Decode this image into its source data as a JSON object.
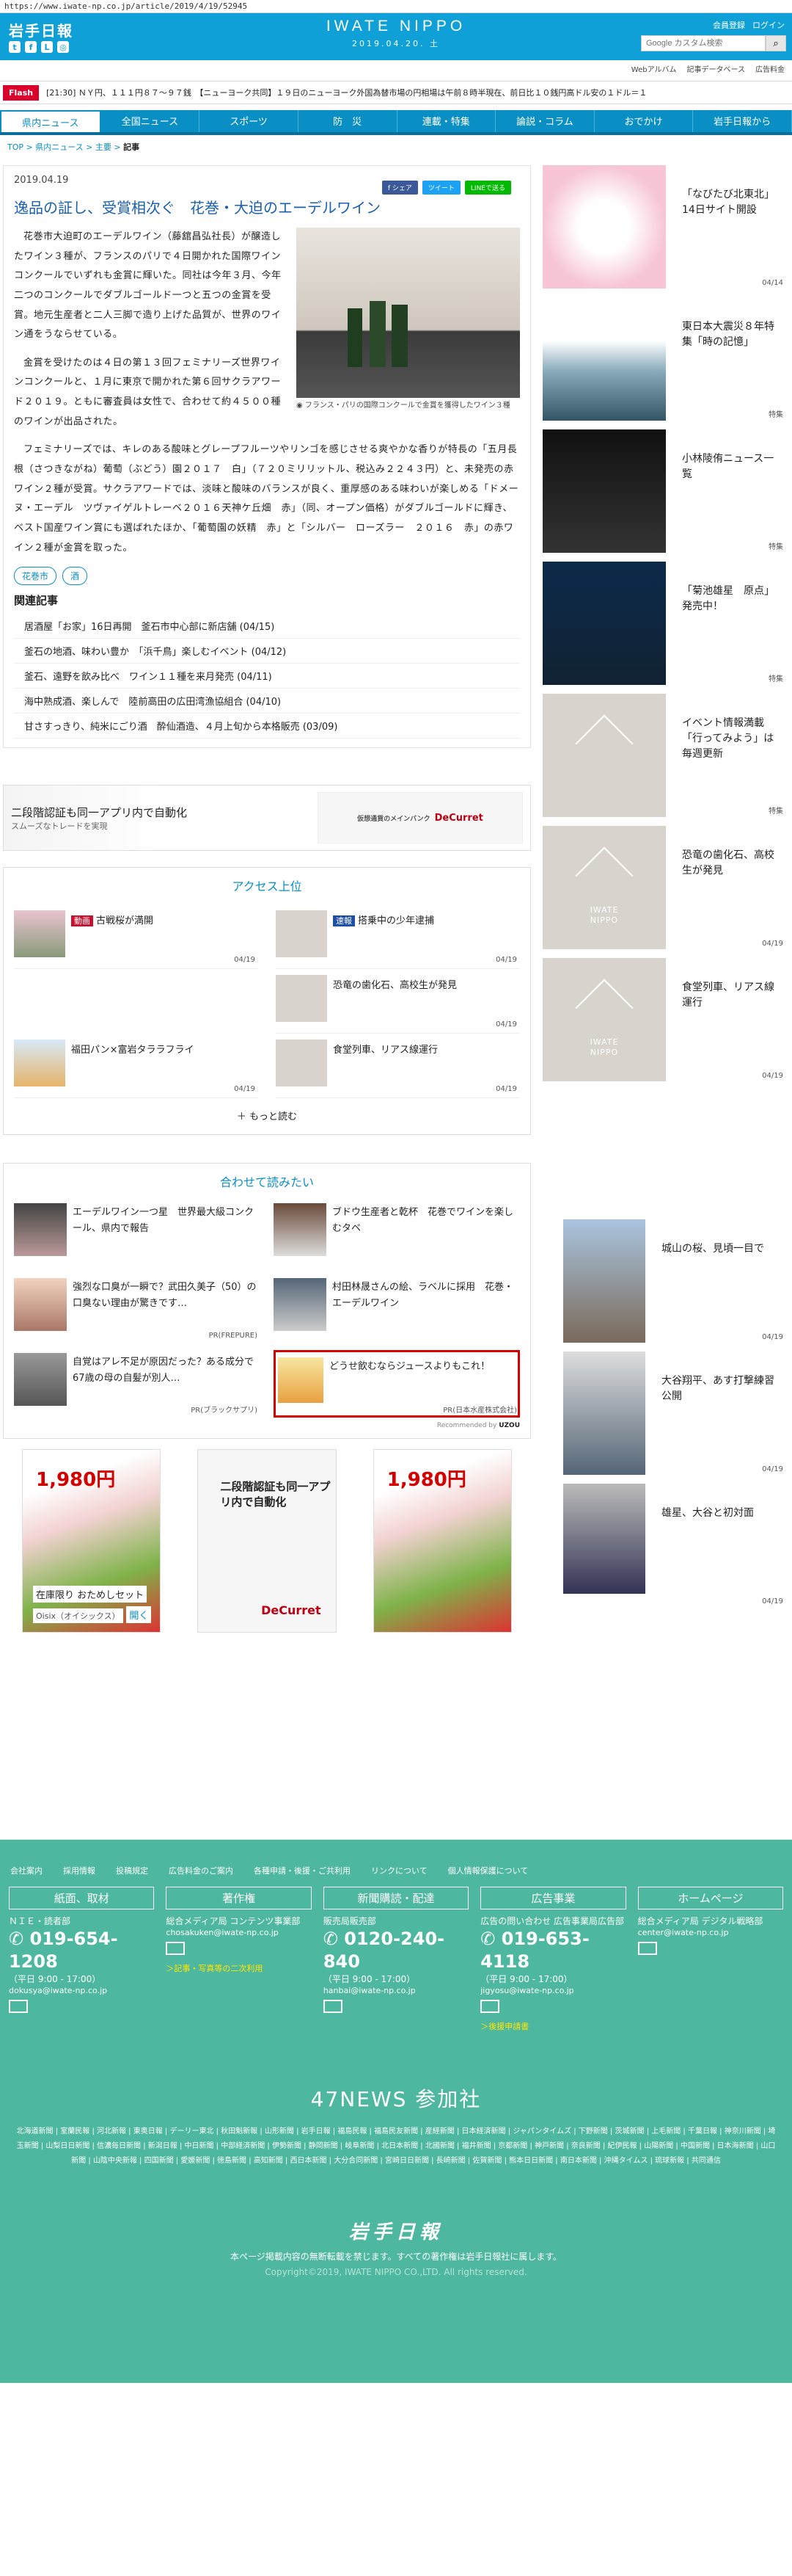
{
  "browser": {
    "url": "https://www.iwate-np.co.jp/article/2019/4/19/52945"
  },
  "header": {
    "site_logo": "岩手日報",
    "center_title": "IWATE NIPPO",
    "center_date": "2019.04.20. 土",
    "member_register": "会員登録",
    "login": "ログイン",
    "search_placeholder": "Google カスタム検索",
    "util_links": [
      "Webアルバム",
      "記事データベース",
      "広告料金"
    ]
  },
  "flash": {
    "label": "Flash",
    "text": "[21:30] ＮＹ円、１１１円８７～９７銭　【ニューヨーク共同】１９日のニューヨーク外国為替市場の円相場は午前８時半現在、前日比１０銭円高ドル安の１ドル＝１"
  },
  "nav": [
    "県内ニュース",
    "全国ニュース",
    "スポーツ",
    "防　災",
    "連載・特集",
    "論説・コラム",
    "おでかけ",
    "岩手日報から"
  ],
  "breadcrumb": {
    "top": "TOP",
    "cat": "県内ニュース",
    "sub": "主要",
    "cur": "記事"
  },
  "article": {
    "date": "2019.04.19",
    "share": [
      "f シェア",
      "ツイート",
      "LINEで送る"
    ],
    "title": "逸品の証し、受賞相次ぐ　花巻・大迫のエーデルワイン",
    "photo_caption": "フランス・パリの国際コンクールで金賞を獲得したワイン３種",
    "paragraphs": [
      "花巻市大迫町のエーデルワイン（藤舘昌弘社長）が醸造したワイン３種が、フランスのパリで４日開かれた国際ワインコンクールでいずれも金賞に輝いた。同社は今年３月、今年二つのコンクールでダブルゴールド一つと五つの金賞を受賞。地元生産者と二人三脚で造り上げた品質が、世界のワイン通をうならせている。",
      "金賞を受けたのは４日の第１３回フェミナリーズ世界ワインコンクールと、１月に東京で開かれた第６回サクラアワード２０１９。ともに審査員は女性で、合わせて約４５００種のワインが出品された。",
      "フェミナリーズでは、キレのある酸味とグレープフルーツやリンゴを感じさせる爽やかな香りが特長の「五月長根（さつきながね）葡萄（ぶどう）園２０１７　白」（７２０ミリリットル、税込み２２４３円）と、未発売の赤ワイン２種が受賞。サクラアワードでは、淡味と酸味のバランスが良く、重厚感のある味わいが楽しめる「ドメーヌ・エーデル　ツヴァイゲルトレーベ２０１６天神ケ丘畑　赤」（同、オープン価格）がダブルゴールドに輝き、ベスト国産ワイン賞にも選ばれたほか、「葡萄園の妖精　赤」と「シルバー　ローズラー　２０１６　赤」の赤ワイン２種が金賞を取った。"
    ],
    "tags": [
      "花巻市",
      "酒"
    ],
    "related_title": "関連記事",
    "related": [
      "居酒屋「お家」16日再開　釜石市中心部に新店舗 (04/15)",
      "釜石の地酒、味わい豊か　「浜千鳥」楽しむイベント (04/12)",
      "釜石、遠野を飲み比べ　ワイン１１種を来月発売 (04/11)",
      "海中熟成酒、楽しんで　陸前高田の広田湾漁協組合 (04/10)",
      "甘さすっきり、純米にごり酒　酔仙酒造、４月上旬から本格販売 (03/09)"
    ]
  },
  "ad_banner": {
    "left": "二段階認証も同一アプリ内で自動化",
    "left_sub": "スムーズなトレードを実現",
    "right": "DeCurret",
    "right_sub": "仮想通貨のメインバンク"
  },
  "access": {
    "title": "アクセス上位",
    "items": [
      {
        "badge": "動画",
        "badge_color": "#c8102e",
        "text": "古戦桜が満開",
        "date": "04/19"
      },
      {
        "badge": "速報",
        "badge_color": "#1d4fa8",
        "text": "搭乗中の少年逮捕",
        "date": "04/19"
      },
      {
        "badge": "",
        "badge_color": "",
        "text": "",
        "date": ""
      },
      {
        "badge": "",
        "badge_color": "",
        "text": "恐竜の歯化石、高校生が発見",
        "date": "04/19"
      },
      {
        "badge": "",
        "badge_color": "",
        "text": "福田パン×富岩タララフライ",
        "date": "04/19"
      },
      {
        "badge": "",
        "badge_color": "",
        "text": "食堂列車、リアス線運行",
        "date": "04/19"
      }
    ],
    "more": "＋ もっと読む"
  },
  "recommend": {
    "title": "合わせて読みたい",
    "items": [
      {
        "text": "エーデルワイン一つ星　世界最大級コンクール、県内で報告",
        "pr": ""
      },
      {
        "text": "ブドウ生産者と乾杯　花巻でワインを楽しむタベ",
        "pr": ""
      },
      {
        "text": "強烈な口臭が一瞬で？武田久美子（50）の口臭ない理由が驚きです…",
        "pr": "PR(FREPURE)"
      },
      {
        "text": "村田林晟さんの絵、ラベルに採用　花巻・エーデルワイン",
        "pr": ""
      },
      {
        "text": "自覚はアレ不足が原因だった？ある成分で67歳の母の自髪が別人…",
        "pr": "PR(ブラックサプリ)"
      },
      {
        "text": "どうせ飲むならジュースよりもこれ！",
        "pr": "PR(日本水産株式会社)"
      }
    ],
    "powered": "Recommended by"
  },
  "bottom_ads": {
    "oisix_price": "1,980円",
    "oisix_text": "在庫限り おためしセット",
    "oisix_brand": "Oisix（オイシックス）",
    "oisix_open": "開く",
    "decurret_text": "二段階認証も同一アプリ内で自動化",
    "decurret_brand": "DeCurret",
    "oisix_price2": "1,980円"
  },
  "sidebar": [
    {
      "text": "「なびたび北東北」14日サイト開設",
      "date": "04/14",
      "type": "img"
    },
    {
      "text": "東日本大震災８年特集「時の記憶」",
      "date": "特集",
      "type": "img"
    },
    {
      "text": "小林陵侑ニュース一覧",
      "date": "特集",
      "type": "img"
    },
    {
      "text": "「菊池雄星　原点」発売中！",
      "date": "特集",
      "type": "img"
    },
    {
      "text": "イベント情報満載「行ってみよう」は毎週更新",
      "date": "特集",
      "type": "img"
    },
    {
      "text": "恐竜の歯化石、高校生が発見",
      "date": "04/19",
      "type": "logo"
    },
    {
      "text": "食堂列車、リアス線運行",
      "date": "04/19",
      "type": "logo"
    },
    {
      "text": "城山の桜、見頃一目で",
      "date": "04/19",
      "type": "img"
    },
    {
      "text": "大谷翔平、あす打撃練習公開",
      "date": "04/19",
      "type": "img"
    },
    {
      "text": "雄星、大谷と初対面",
      "date": "04/19",
      "type": "img"
    }
  ],
  "footer": {
    "links": [
      "会社案内",
      "採用情報",
      "投稿規定",
      "広告料金のご案内",
      "各種申請・後援・ご共利用",
      "リンクについて",
      "個人情報保護について"
    ],
    "cols": [
      {
        "head": "紙面、取材",
        "sub": "ＮＩＥ・読者部",
        "phone": "019-654-1208",
        "hours": "（平日 9:00 - 17:00）",
        "email": "dokusya@iwate-np.co.jp",
        "link": ""
      },
      {
        "head": "著作権",
        "sub": "総合メディア局 コンテンツ事業部",
        "phone": "",
        "hours": "",
        "email": "chosakuken@iwate-np.co.jp",
        "link": "＞記事・写真等の二次利用"
      },
      {
        "head": "新聞購読・配達",
        "sub": "販売局販売部",
        "phone": "0120-240-840",
        "hours": "（平日 9:00 - 17:00）",
        "email": "hanbai@iwate-np.co.jp",
        "link": ""
      },
      {
        "head": "広告事業",
        "sub": "広告の問い合わせ 広告事業局広告部",
        "phone": "019-653-4118",
        "hours": "（平日 9:00 - 17:00）",
        "email": "jigyosu@iwate-np.co.jp",
        "link": "＞後援申請書"
      },
      {
        "head": "ホームページ",
        "sub": "総合メディア局 デジタル戦略部",
        "phone": "",
        "hours": "",
        "email": "center@iwate-np.co.jp",
        "link": ""
      }
    ],
    "news47": "47NEWS 参加社",
    "papers": "北海道新聞 | 室蘭民報 | 河北新報 | 東奥日報 | デーリー東北 | 秋田魁新報 | 山形新聞 | 岩手日報 | 福島民報 | 福島民友新聞 | 産経新聞 | 日本経済新聞 | ジャパンタイムズ | 下野新聞 | 茨城新聞 | 上毛新聞 | 千葉日報 | 神奈川新聞 | 埼玉新聞 | 山梨日日新聞 | 信濃毎日新聞 | 新潟日報 | 中日新聞 | 中部経済新聞 | 伊勢新聞 | 静岡新聞 | 岐阜新聞 | 北日本新聞 | 北國新聞 | 福井新聞 | 京都新聞 | 神戸新聞 | 奈良新聞 | 紀伊民報 | 山陽新聞 | 中国新聞 | 日本海新聞 | 山口新聞 | 山陰中央新報 | 四国新聞 | 愛媛新聞 | 徳島新聞 | 高知新聞 | 西日本新聞 | 大分合同新聞 | 宮崎日日新聞 | 長崎新聞 | 佐賀新聞 | 熊本日日新聞 | 南日本新聞 | 沖縄タイムス | 琉球新報 | 共同通信",
    "logo": "岩手日報",
    "note": "本ページ掲載内容の無断転載を禁じます。すべての著作権は岩手日報社に属します。",
    "copy": "Copyright©2019, IWATE NIPPO CO.,LTD. All rights reserved."
  }
}
